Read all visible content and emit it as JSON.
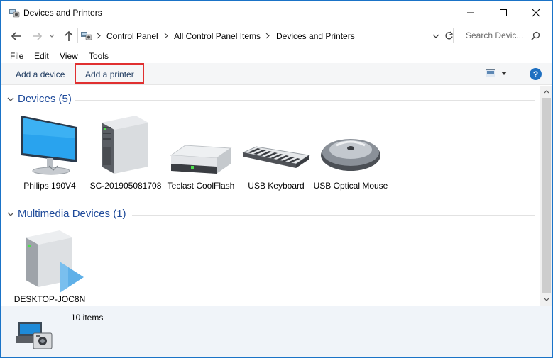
{
  "window": {
    "title": "Devices and Printers",
    "icons": [
      "devices-printers-icon",
      "minimize-icon",
      "maximize-icon",
      "close-icon"
    ]
  },
  "address": {
    "crumbs": [
      "Control Panel",
      "All Control Panel Items",
      "Devices and Printers"
    ],
    "search_placeholder": "Search Devic...",
    "icons": [
      "back-arrow-icon",
      "forward-arrow-icon",
      "up-arrow-icon",
      "location-icon",
      "chevron-right-icon",
      "chevron-down-icon",
      "refresh-icon",
      "search-icon"
    ]
  },
  "menu": {
    "items": [
      "File",
      "Edit",
      "View",
      "Tools"
    ]
  },
  "commands": {
    "add_device": "Add a device",
    "add_printer": "Add a printer",
    "help": "?",
    "highlight_color": "#e03030"
  },
  "groups": [
    {
      "title": "Devices (5)",
      "devices": [
        {
          "label": "Philips 190V4",
          "icon": "monitor-icon"
        },
        {
          "label": "SC-201905081708",
          "icon": "computer-tower-icon"
        },
        {
          "label": "Teclast CoolFlash",
          "icon": "usb-drive-icon"
        },
        {
          "label": "USB Keyboard",
          "icon": "keyboard-icon"
        },
        {
          "label": "USB Optical Mouse",
          "icon": "mouse-icon"
        }
      ]
    },
    {
      "title": "Multimedia Devices (1)",
      "devices": [
        {
          "label": "DESKTOP-JOC8N",
          "icon": "media-server-icon"
        }
      ]
    }
  ],
  "details": {
    "count": "10 items",
    "icon": "devices-printers-large-icon"
  },
  "colors": {
    "accent": "#1f70c1",
    "group_title": "#1e4a9a",
    "command_bar": "#f5f6f7",
    "details_pane": "#f0f4f9"
  }
}
